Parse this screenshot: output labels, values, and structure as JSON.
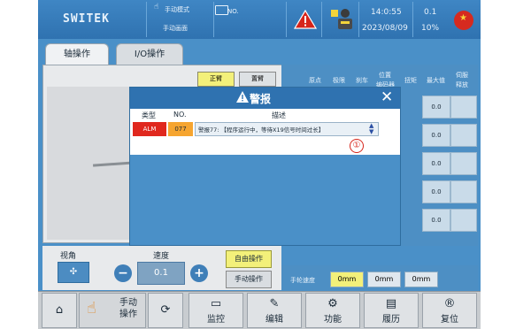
{
  "header": {
    "logo": "SWITEK",
    "mode_label": "手动模式",
    "screen_label": "手动画面",
    "program_label": "NO.",
    "time": "14:0:55",
    "date": "2023/08/09",
    "value_top": "0.1",
    "value_bottom": "10%",
    "warning_icon": "warning-triangle-icon",
    "robot_icon": "robot-status-icon",
    "flag_icon": "china-flag-icon"
  },
  "tabs": [
    {
      "label": "轴操作",
      "active": true
    },
    {
      "label": "I/O操作",
      "active": false
    }
  ],
  "left_panel": {
    "btn_forward": "正臂",
    "btn_reset": "置臂",
    "view_label": "视角",
    "speed_label": "速度",
    "speed_value": "0.1",
    "free_btn": "自由操作",
    "manual_btn": "手动操作"
  },
  "right_panel": {
    "headers": [
      "原点",
      "极限",
      "刹车",
      "位置",
      "扭矩",
      "最大值",
      "伺服"
    ],
    "header_sub_position": "编码器",
    "header_sub_servo": "释放",
    "max_values": [
      "0.0",
      "0.0",
      "0.0",
      "0.0",
      "0.0"
    ],
    "handwheel_label": "手轮速度",
    "handwheel_options": [
      {
        "label": "0mm",
        "selected": true
      },
      {
        "label": "0mm",
        "selected": false
      },
      {
        "label": "0mm",
        "selected": false
      }
    ]
  },
  "nav": {
    "home": "",
    "manual": "手动\n操作",
    "refresh": "",
    "monitor": "监控",
    "edit": "编辑",
    "function": "功能",
    "history": "履历",
    "reset": "复位"
  },
  "alert": {
    "title": "警报",
    "col_type": "类型",
    "col_no": "NO.",
    "col_desc": "描述",
    "row_type": "ALM",
    "row_no": "077",
    "row_desc": "警报77: 【程序运行中，等待X19信号时间过长】",
    "marker": "①",
    "type_color": "#e0281e",
    "no_color": "#f6a530"
  }
}
